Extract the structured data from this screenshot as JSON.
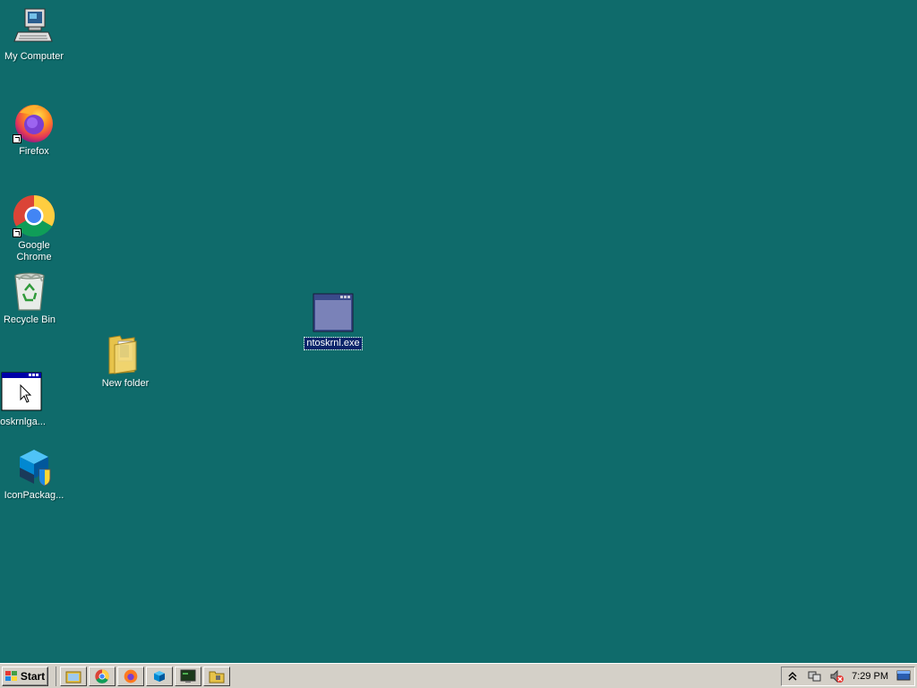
{
  "desktop": {
    "background_color": "#0f6b6b",
    "icons": [
      {
        "label": "My Computer",
        "icon": "my-computer-icon"
      },
      {
        "label": "Firefox",
        "icon": "firefox-icon"
      },
      {
        "label": "Google Chrome",
        "icon": "chrome-icon"
      },
      {
        "label": "Recycle Bin",
        "icon": "recycle-bin-icon"
      },
      {
        "label": "New folder",
        "icon": "folder-icon"
      },
      {
        "label": "ntoskrnl.exe",
        "icon": "exe-window-icon",
        "selected": true
      },
      {
        "label": "toskrnlga...",
        "icon": "exe-window-icon"
      },
      {
        "label": "IconPackag...",
        "icon": "iconpackager-icon"
      }
    ]
  },
  "taskbar": {
    "start_label": "Start",
    "quick_launch": [
      {
        "icon": "explorer-icon"
      },
      {
        "icon": "chrome-icon"
      },
      {
        "icon": "firefox-icon"
      },
      {
        "icon": "iconpackager-icon"
      },
      {
        "icon": "terminal-icon"
      },
      {
        "icon": "folder-icon"
      }
    ],
    "tray": {
      "clock": "7:29 PM",
      "icons": [
        "expand-arrow-icon",
        "network-icon",
        "volume-muted-icon",
        "desktop-icon"
      ]
    }
  }
}
